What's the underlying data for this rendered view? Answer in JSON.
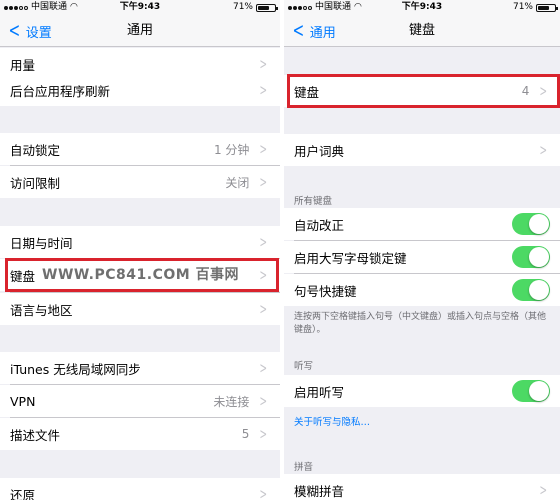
{
  "colors": {
    "accent": "#007aff",
    "toggle_on": "#4cd964",
    "highlight": "#d9232d",
    "background": "#efeff4"
  },
  "left": {
    "status": {
      "carrier": "中国联通",
      "time": "下午9:43",
      "battery": "71%",
      "battery_level": 0.71
    },
    "nav": {
      "back_label": "设置",
      "title": "通用"
    },
    "rows": {
      "usage": {
        "label": "用量"
      },
      "bg_refresh": {
        "label": "后台应用程序刷新"
      },
      "auto_lock": {
        "label": "自动锁定",
        "value": "1 分钟"
      },
      "restrictions": {
        "label": "访问限制",
        "value": "关闭"
      },
      "date_time": {
        "label": "日期与时间"
      },
      "keyboard": {
        "label": "键盘"
      },
      "language": {
        "label": "语言与地区"
      },
      "itunes_sync": {
        "label": "iTunes 无线局域网同步"
      },
      "vpn": {
        "label": "VPN",
        "value": "未连接"
      },
      "profiles": {
        "label": "描述文件",
        "value": "5"
      },
      "reset": {
        "label": "还原"
      }
    },
    "watermark": "WWW.PC841.COM 百事网"
  },
  "right": {
    "status": {
      "carrier": "中国联通",
      "time": "下午9:43",
      "battery": "71%",
      "battery_level": 0.71
    },
    "nav": {
      "back_label": "通用",
      "title": "键盘"
    },
    "rows": {
      "keyboards": {
        "label": "键盘",
        "value": "4"
      },
      "user_dictionary": {
        "label": "用户词典"
      },
      "auto_correct": {
        "label": "自动改正",
        "on": true
      },
      "caps_lock": {
        "label": "启用大写字母锁定键",
        "on": true
      },
      "period_shortcut": {
        "label": "句号快捷键",
        "on": true
      },
      "enable_dictation": {
        "label": "启用听写",
        "on": true
      },
      "fuzzy_pinyin": {
        "label": "模糊拼音"
      }
    },
    "section_all_keyboards": "所有键盘",
    "period_note": "连按两下空格键插入句号（中文键盘）或插入句点与空格（其他键盘）。",
    "section_dictation": "听写",
    "dictation_link": "关于听写与隐私…",
    "section_pinyin": "拼音"
  }
}
